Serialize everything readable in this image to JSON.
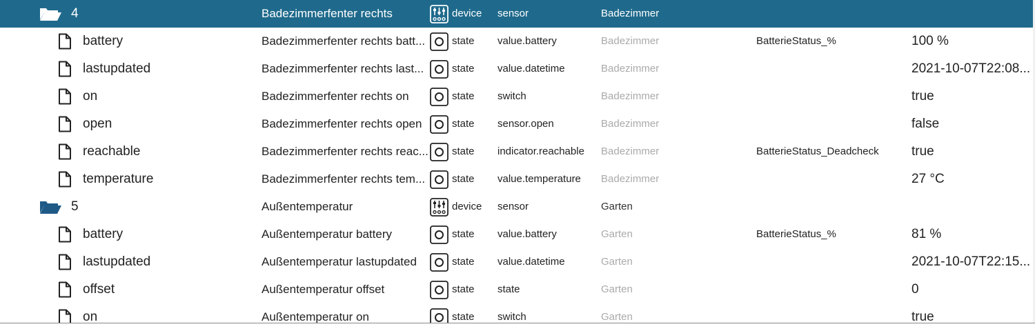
{
  "rows": [
    {
      "kind": "device",
      "selected": true,
      "id": "4",
      "name": "Badezimmerfenter rechts",
      "type": "device",
      "role": "sensor",
      "room": "Badezimmer",
      "function": "",
      "value": ""
    },
    {
      "kind": "state",
      "id": "battery",
      "name": "Badezimmerfenter rechts batt...",
      "type": "state",
      "role": "value.battery",
      "room": "Badezimmer",
      "function": "BatterieStatus_%",
      "value": "100 %"
    },
    {
      "kind": "state",
      "id": "lastupdated",
      "name": "Badezimmerfenter rechts last...",
      "type": "state",
      "role": "value.datetime",
      "room": "Badezimmer",
      "function": "",
      "value": "2021-10-07T22:08..."
    },
    {
      "kind": "state",
      "id": "on",
      "name": "Badezimmerfenter rechts on",
      "type": "state",
      "role": "switch",
      "room": "Badezimmer",
      "function": "",
      "value": "true"
    },
    {
      "kind": "state",
      "id": "open",
      "name": "Badezimmerfenter rechts open",
      "type": "state",
      "role": "sensor.open",
      "room": "Badezimmer",
      "function": "",
      "value": "false"
    },
    {
      "kind": "state",
      "id": "reachable",
      "name": "Badezimmerfenter rechts reac...",
      "type": "state",
      "role": "indicator.reachable",
      "room": "Badezimmer",
      "function": "BatterieStatus_Deadcheck",
      "value": "true"
    },
    {
      "kind": "state",
      "id": "temperature",
      "name": "Badezimmerfenter rechts tem...",
      "type": "state",
      "role": "value.temperature",
      "room": "Badezimmer",
      "function": "",
      "value": "27 °C"
    },
    {
      "kind": "device",
      "selected": false,
      "id": "5",
      "name": "Außentemperatur",
      "type": "device",
      "role": "sensor",
      "room": "Garten",
      "function": "",
      "value": ""
    },
    {
      "kind": "state",
      "id": "battery",
      "name": "Außentemperatur battery",
      "type": "state",
      "role": "value.battery",
      "room": "Garten",
      "function": "BatterieStatus_%",
      "value": "81 %"
    },
    {
      "kind": "state",
      "id": "lastupdated",
      "name": "Außentemperatur lastupdated",
      "type": "state",
      "role": "value.datetime",
      "room": "Garten",
      "function": "",
      "value": "2021-10-07T22:15..."
    },
    {
      "kind": "state",
      "id": "offset",
      "name": "Außentemperatur offset",
      "type": "state",
      "role": "state",
      "room": "Garten",
      "function": "",
      "value": "0"
    },
    {
      "kind": "state",
      "id": "on",
      "name": "Außentemperatur on",
      "type": "state",
      "role": "switch",
      "room": "Garten",
      "function": "",
      "value": "true"
    }
  ],
  "colors": {
    "selected_bg": "#1f6a8c",
    "folder": "#1f5a86",
    "muted": "#aaaaaa"
  },
  "icons": {
    "folder": "folder-open-icon",
    "file": "file-icon",
    "device": "device-sliders-icon",
    "state": "state-circle-icon"
  }
}
